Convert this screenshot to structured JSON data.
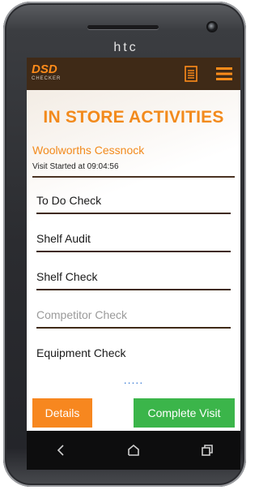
{
  "device": {
    "brand": "htc"
  },
  "app": {
    "logo_main": "DSD",
    "logo_sub": "CHECKER",
    "icons": {
      "list": "list-icon",
      "menu": "hamburger-menu-icon"
    },
    "colors": {
      "app_bar": "#3f2a17",
      "accent": "#f28a1c",
      "success": "#3bb54a",
      "details": "#f7871f"
    }
  },
  "page": {
    "title": "IN STORE ACTIVITIES",
    "store_name": "Woolworths Cessnock",
    "visit_started": "Visit Started at 09:04:56"
  },
  "activities": [
    {
      "label": "To Do Check",
      "enabled": true
    },
    {
      "label": "Shelf Audit",
      "enabled": true
    },
    {
      "label": "Shelf Check",
      "enabled": true
    },
    {
      "label": "Competitor Check",
      "enabled": false
    },
    {
      "label": "Equipment Check",
      "enabled": true
    }
  ],
  "more_indicator": ".....",
  "actions": {
    "details_label": "Details",
    "complete_label": "Complete Visit"
  },
  "navbar": {
    "icons": [
      "back-icon",
      "home-icon",
      "recent-apps-icon"
    ]
  }
}
